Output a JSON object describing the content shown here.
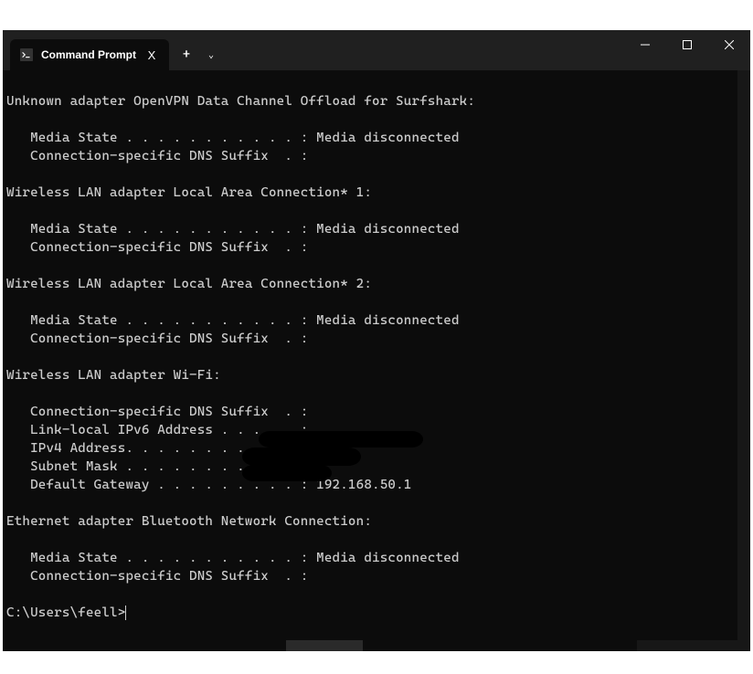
{
  "window": {
    "tab_title": "Command Prompt",
    "close_label": "X",
    "new_tab_label": "+",
    "dropdown_label": "⌄",
    "minimize_label": "–",
    "maximize_label": "▢",
    "win_close_label": "X"
  },
  "terminal": {
    "lines": [
      "",
      "Unknown adapter OpenVPN Data Channel Offload for Surfshark:",
      "",
      "   Media State . . . . . . . . . . . : Media disconnected",
      "   Connection-specific DNS Suffix  . :",
      "",
      "Wireless LAN adapter Local Area Connection* 1:",
      "",
      "   Media State . . . . . . . . . . . : Media disconnected",
      "   Connection-specific DNS Suffix  . :",
      "",
      "Wireless LAN adapter Local Area Connection* 2:",
      "",
      "   Media State . . . . . . . . . . . : Media disconnected",
      "   Connection-specific DNS Suffix  . :",
      "",
      "Wireless LAN adapter Wi-Fi:",
      "",
      "   Connection-specific DNS Suffix  . :",
      "   Link-local IPv6 Address . . . . . :",
      "   IPv4 Address. . . . . . . . . . . :",
      "   Subnet Mask . . . . . . . . . . . :",
      "   Default Gateway . . . . . . . . . : 192.168.50.1",
      "",
      "Ethernet adapter Bluetooth Network Connection:",
      "",
      "   Media State . . . . . . . . . . . : Media disconnected",
      "   Connection-specific DNS Suffix  . :",
      ""
    ],
    "prompt": "C:\\Users\\feell>"
  }
}
